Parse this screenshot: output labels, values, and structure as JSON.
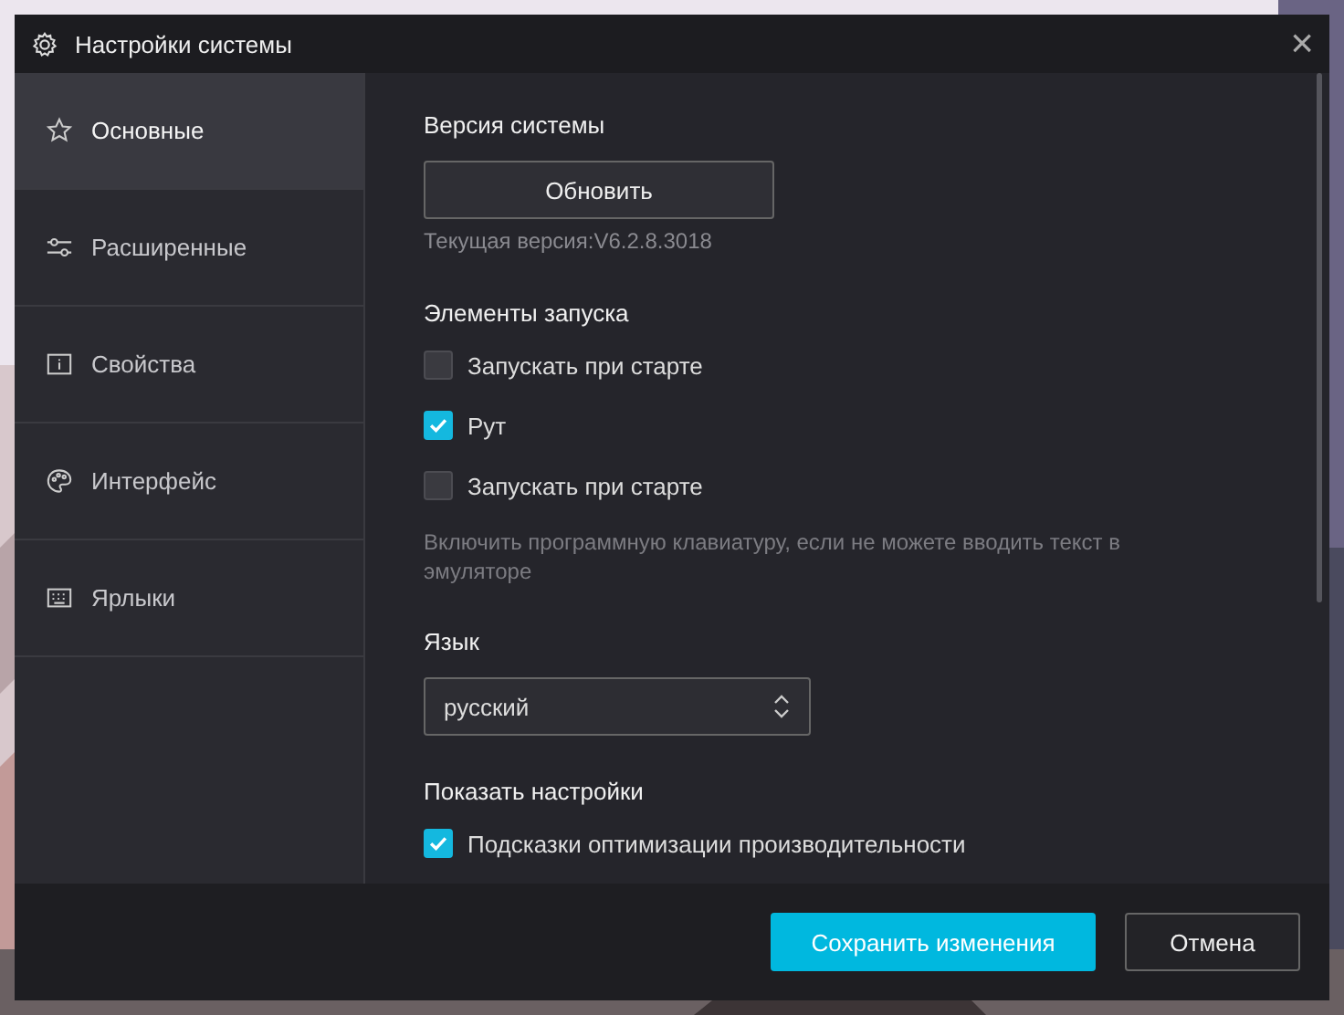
{
  "window": {
    "title": "Настройки системы",
    "close": "×"
  },
  "sidebar": {
    "items": [
      {
        "label": "Основные",
        "selected": true
      },
      {
        "label": "Расширенные",
        "selected": false
      },
      {
        "label": "Свойства",
        "selected": false
      },
      {
        "label": "Интерфейс",
        "selected": false
      },
      {
        "label": "Ярлыки",
        "selected": false
      }
    ]
  },
  "content": [
    {
      "kind": "heading",
      "text": "Версия системы"
    },
    {
      "kind": "button",
      "text": "Обновить"
    },
    {
      "kind": "note",
      "text": "Текущая версия:V6.2.8.3018"
    },
    {
      "kind": "heading",
      "text": "Элементы запуска"
    },
    {
      "kind": "checkbox",
      "text": "Запускать при старте",
      "checked": false
    },
    {
      "kind": "checkbox",
      "text": "Рут",
      "checked": true
    },
    {
      "kind": "checkbox",
      "text": "Запускать при старте",
      "checked": false
    },
    {
      "kind": "hint",
      "text": "Включить программную клавиатуру, если не можете вводить текст в эмуляторе"
    },
    {
      "kind": "heading",
      "text": "Язык"
    },
    {
      "kind": "select",
      "text": "русский"
    },
    {
      "kind": "heading",
      "text": "Показать настройки"
    },
    {
      "kind": "checkbox",
      "text": "Подсказки оптимизации производительности",
      "checked": true
    }
  ],
  "buttons": [
    {
      "label": "Сохранить изменения",
      "primary": true
    },
    {
      "label": "Отмена",
      "primary": false
    }
  ]
}
